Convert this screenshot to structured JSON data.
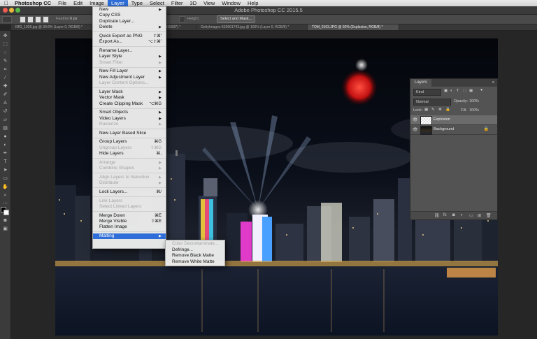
{
  "menubar": {
    "app": "Photoshop CC",
    "items": [
      "File",
      "Edit",
      "Image",
      "Layer",
      "Type",
      "Select",
      "Filter",
      "3D",
      "View",
      "Window",
      "Help"
    ]
  },
  "window": {
    "title": "Adobe Photoshop CC 2015.5"
  },
  "options": {
    "feather_label": "Feather:",
    "feather_value": "0 px",
    "height_label": "Height:",
    "select_mask": "Select and Mask..."
  },
  "tabs": [
    "IMG_1026.jpg @ 30.6% (Layer 0, RGB/8) *",
    "GettyImages-498792379.jpg @ 33.3% (RGB/8*) *",
    "GettyImages-539661743.jpg @ 100% (Layer 0, RGB/8) *",
    "TOM_0103.JPG @ 50% (Explosion, RGB/8) *"
  ],
  "layer_menu": [
    {
      "label": "New",
      "sub": true
    },
    {
      "label": "Copy CSS"
    },
    {
      "label": "Duplicate Layer..."
    },
    {
      "label": "Delete",
      "sub": true
    },
    {
      "sep": true
    },
    {
      "label": "Quick Export as PNG",
      "shortcut": "⇧⌘'"
    },
    {
      "label": "Export As...",
      "shortcut": "⌥⇧⌘'"
    },
    {
      "sep": true
    },
    {
      "label": "Rename Layer..."
    },
    {
      "label": "Layer Style",
      "sub": true
    },
    {
      "label": "Smart Filter",
      "disabled": true,
      "sub": true
    },
    {
      "sep": true
    },
    {
      "label": "New Fill Layer",
      "sub": true
    },
    {
      "label": "New Adjustment Layer",
      "sub": true
    },
    {
      "label": "Layer Content Options...",
      "disabled": true
    },
    {
      "sep": true
    },
    {
      "label": "Layer Mask",
      "sub": true
    },
    {
      "label": "Vector Mask",
      "sub": true
    },
    {
      "label": "Create Clipping Mask",
      "shortcut": "⌥⌘G"
    },
    {
      "sep": true
    },
    {
      "label": "Smart Objects",
      "sub": true
    },
    {
      "label": "Video Layers",
      "sub": true
    },
    {
      "label": "Rasterize",
      "disabled": true,
      "sub": true
    },
    {
      "sep": true
    },
    {
      "label": "New Layer Based Slice"
    },
    {
      "sep": true
    },
    {
      "label": "Group Layers",
      "shortcut": "⌘G"
    },
    {
      "label": "Ungroup Layers",
      "shortcut": "⇧⌘G",
      "disabled": true
    },
    {
      "label": "Hide Layers",
      "shortcut": "⌘,"
    },
    {
      "sep": true
    },
    {
      "label": "Arrange",
      "disabled": true,
      "sub": true
    },
    {
      "label": "Combine Shapes",
      "disabled": true,
      "sub": true
    },
    {
      "sep": true
    },
    {
      "label": "Align Layers to Selection",
      "disabled": true,
      "sub": true
    },
    {
      "label": "Distribute",
      "disabled": true,
      "sub": true
    },
    {
      "sep": true
    },
    {
      "label": "Lock Layers...",
      "shortcut": "⌘/"
    },
    {
      "sep": true
    },
    {
      "label": "Link Layers",
      "disabled": true
    },
    {
      "label": "Select Linked Layers",
      "disabled": true
    },
    {
      "sep": true
    },
    {
      "label": "Merge Down",
      "shortcut": "⌘E"
    },
    {
      "label": "Merge Visible",
      "shortcut": "⇧⌘E"
    },
    {
      "label": "Flatten Image"
    },
    {
      "sep": true
    },
    {
      "label": "Matting",
      "sub": true,
      "highlight": true
    }
  ],
  "matting_menu": [
    {
      "label": "Color Decontaminate...",
      "disabled": true
    },
    {
      "label": "Defringe..."
    },
    {
      "label": "Remove Black Matte"
    },
    {
      "label": "Remove White Matte"
    }
  ],
  "layers_panel": {
    "title": "Layers",
    "filter_kind": "Kind",
    "blend_mode": "Normal",
    "opacity_label": "Opacity:",
    "opacity_value": "100%",
    "lock_label": "Lock:",
    "fill_label": "Fill:",
    "fill_value": "100%",
    "layers": [
      {
        "name": "Explosion",
        "selected": true
      },
      {
        "name": "Background",
        "locked": true
      }
    ]
  },
  "colors": {
    "accent": "#2f6ed8",
    "ui_dark": "#262626",
    "panel": "#535353"
  }
}
